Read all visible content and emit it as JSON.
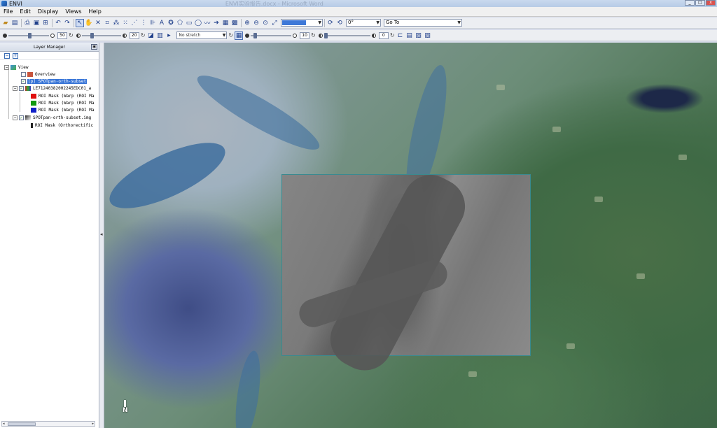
{
  "window": {
    "title": "ENVI",
    "background_title": "ENVI实验报告.docx - Microsoft Word"
  },
  "menu": [
    "File",
    "Edit",
    "Display",
    "Views",
    "Help"
  ],
  "toolbar": {
    "rotation_value": "0°",
    "goto_label": "Go To"
  },
  "display_bar": {
    "brightness": "50",
    "contrast": "20",
    "stretch": "No stretch",
    "sharpen": "10",
    "transparency": "0"
  },
  "layer_manager": {
    "title": "Layer Manager",
    "tree": {
      "root": "View",
      "overview": "Overview",
      "selected_layer": "[p] SPOTpan-orth-subset",
      "landsat_layer": "LE71240382002245EDC01_a",
      "roi_items": [
        "ROI Mask (Warp (ROI Ma",
        "ROI Mask (Warp (ROI Ma",
        "ROI Mask (Warp (ROI Ma"
      ],
      "roi_colors": [
        "#e01010",
        "#119911",
        "#1020c8"
      ],
      "spot_layer": "SPOTpan-orth-subset.img",
      "spot_roi": "ROI Mask (Orthorectific"
    }
  },
  "map": {
    "north_label": "N"
  }
}
